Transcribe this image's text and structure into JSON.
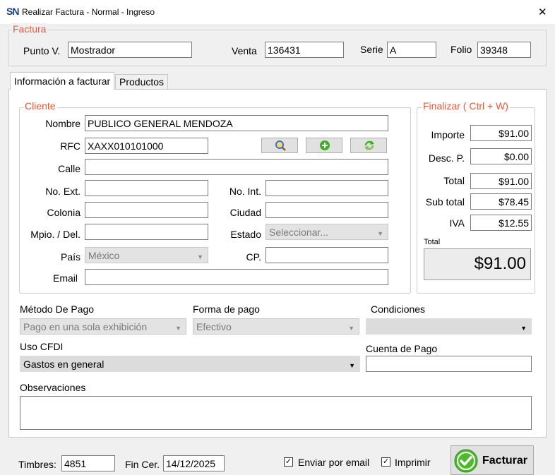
{
  "window": {
    "logo_text": "SN",
    "title": "Realizar Factura - Normal - Ingreso",
    "close_symbol": "✕"
  },
  "factura": {
    "legend": "Factura",
    "punto_v_label": "Punto V.",
    "punto_v_value": "Mostrador",
    "venta_label": "Venta",
    "venta_value": "136431",
    "serie_label": "Serie",
    "serie_value": "A",
    "folio_label": "Folio",
    "folio_value": "39348"
  },
  "tabs": [
    {
      "label": "Información a facturar",
      "active": true
    },
    {
      "label": "Productos",
      "active": false
    }
  ],
  "cliente": {
    "legend": "Cliente",
    "nombre_label": "Nombre",
    "nombre_value": "PUBLICO GENERAL MENDOZA",
    "rfc_label": "RFC",
    "rfc_value": "XAXX010101000",
    "calle_label": "Calle",
    "calle_value": "",
    "no_ext_label": "No. Ext.",
    "no_ext_value": "",
    "no_int_label": "No. Int.",
    "no_int_value": "",
    "colonia_label": "Colonia",
    "colonia_value": "",
    "ciudad_label": "Ciudad",
    "ciudad_value": "",
    "mpio_label": "Mpio. / Del.",
    "mpio_value": "",
    "estado_label": "Estado",
    "estado_value": "Seleccionar...",
    "pais_label": "País",
    "pais_value": "México",
    "cp_label": "CP.",
    "cp_value": "",
    "email_label": "Email",
    "email_value": "",
    "buttons": [
      {
        "icon": "search-icon"
      },
      {
        "icon": "add-icon"
      },
      {
        "icon": "refresh-icon"
      }
    ]
  },
  "finalizar": {
    "legend": "Finalizar ( Ctrl + W)",
    "importe_label": "Importe",
    "importe_value": "$91.00",
    "desc_label": "Desc. P.",
    "desc_value": "$0.00",
    "total_label": "Total",
    "total_value": "$91.00",
    "subtotal_label": "Sub total",
    "subtotal_value": "$78.45",
    "iva_label": "IVA",
    "iva_value": "$12.55",
    "grand_label": "Total",
    "grand_value": "$91.00"
  },
  "pago": {
    "metodo_label": "Método De Pago",
    "metodo_value": "Pago en una sola exhibición",
    "forma_label": "Forma de pago",
    "forma_value": "Efectivo",
    "condiciones_label": "Condiciones",
    "condiciones_value": "",
    "uso_label": "Uso CFDI",
    "uso_value": "Gastos en general",
    "cuenta_label": "Cuenta de Pago",
    "cuenta_value": "",
    "observaciones_label": "Observaciones",
    "observaciones_value": ""
  },
  "footer": {
    "timbres_label": "Timbres:",
    "timbres_value": "4851",
    "fin_cer_label": "Fin Cer.",
    "fin_cer_value": "14/12/2025",
    "enviar_label": "Enviar por email",
    "enviar_checked": true,
    "imprimir_label": "Imprimir",
    "imprimir_checked": true,
    "facturar_label": "Facturar"
  },
  "colors": {
    "accent_legend": "#e8593a",
    "facturar_icon": "#4cbb2a"
  }
}
